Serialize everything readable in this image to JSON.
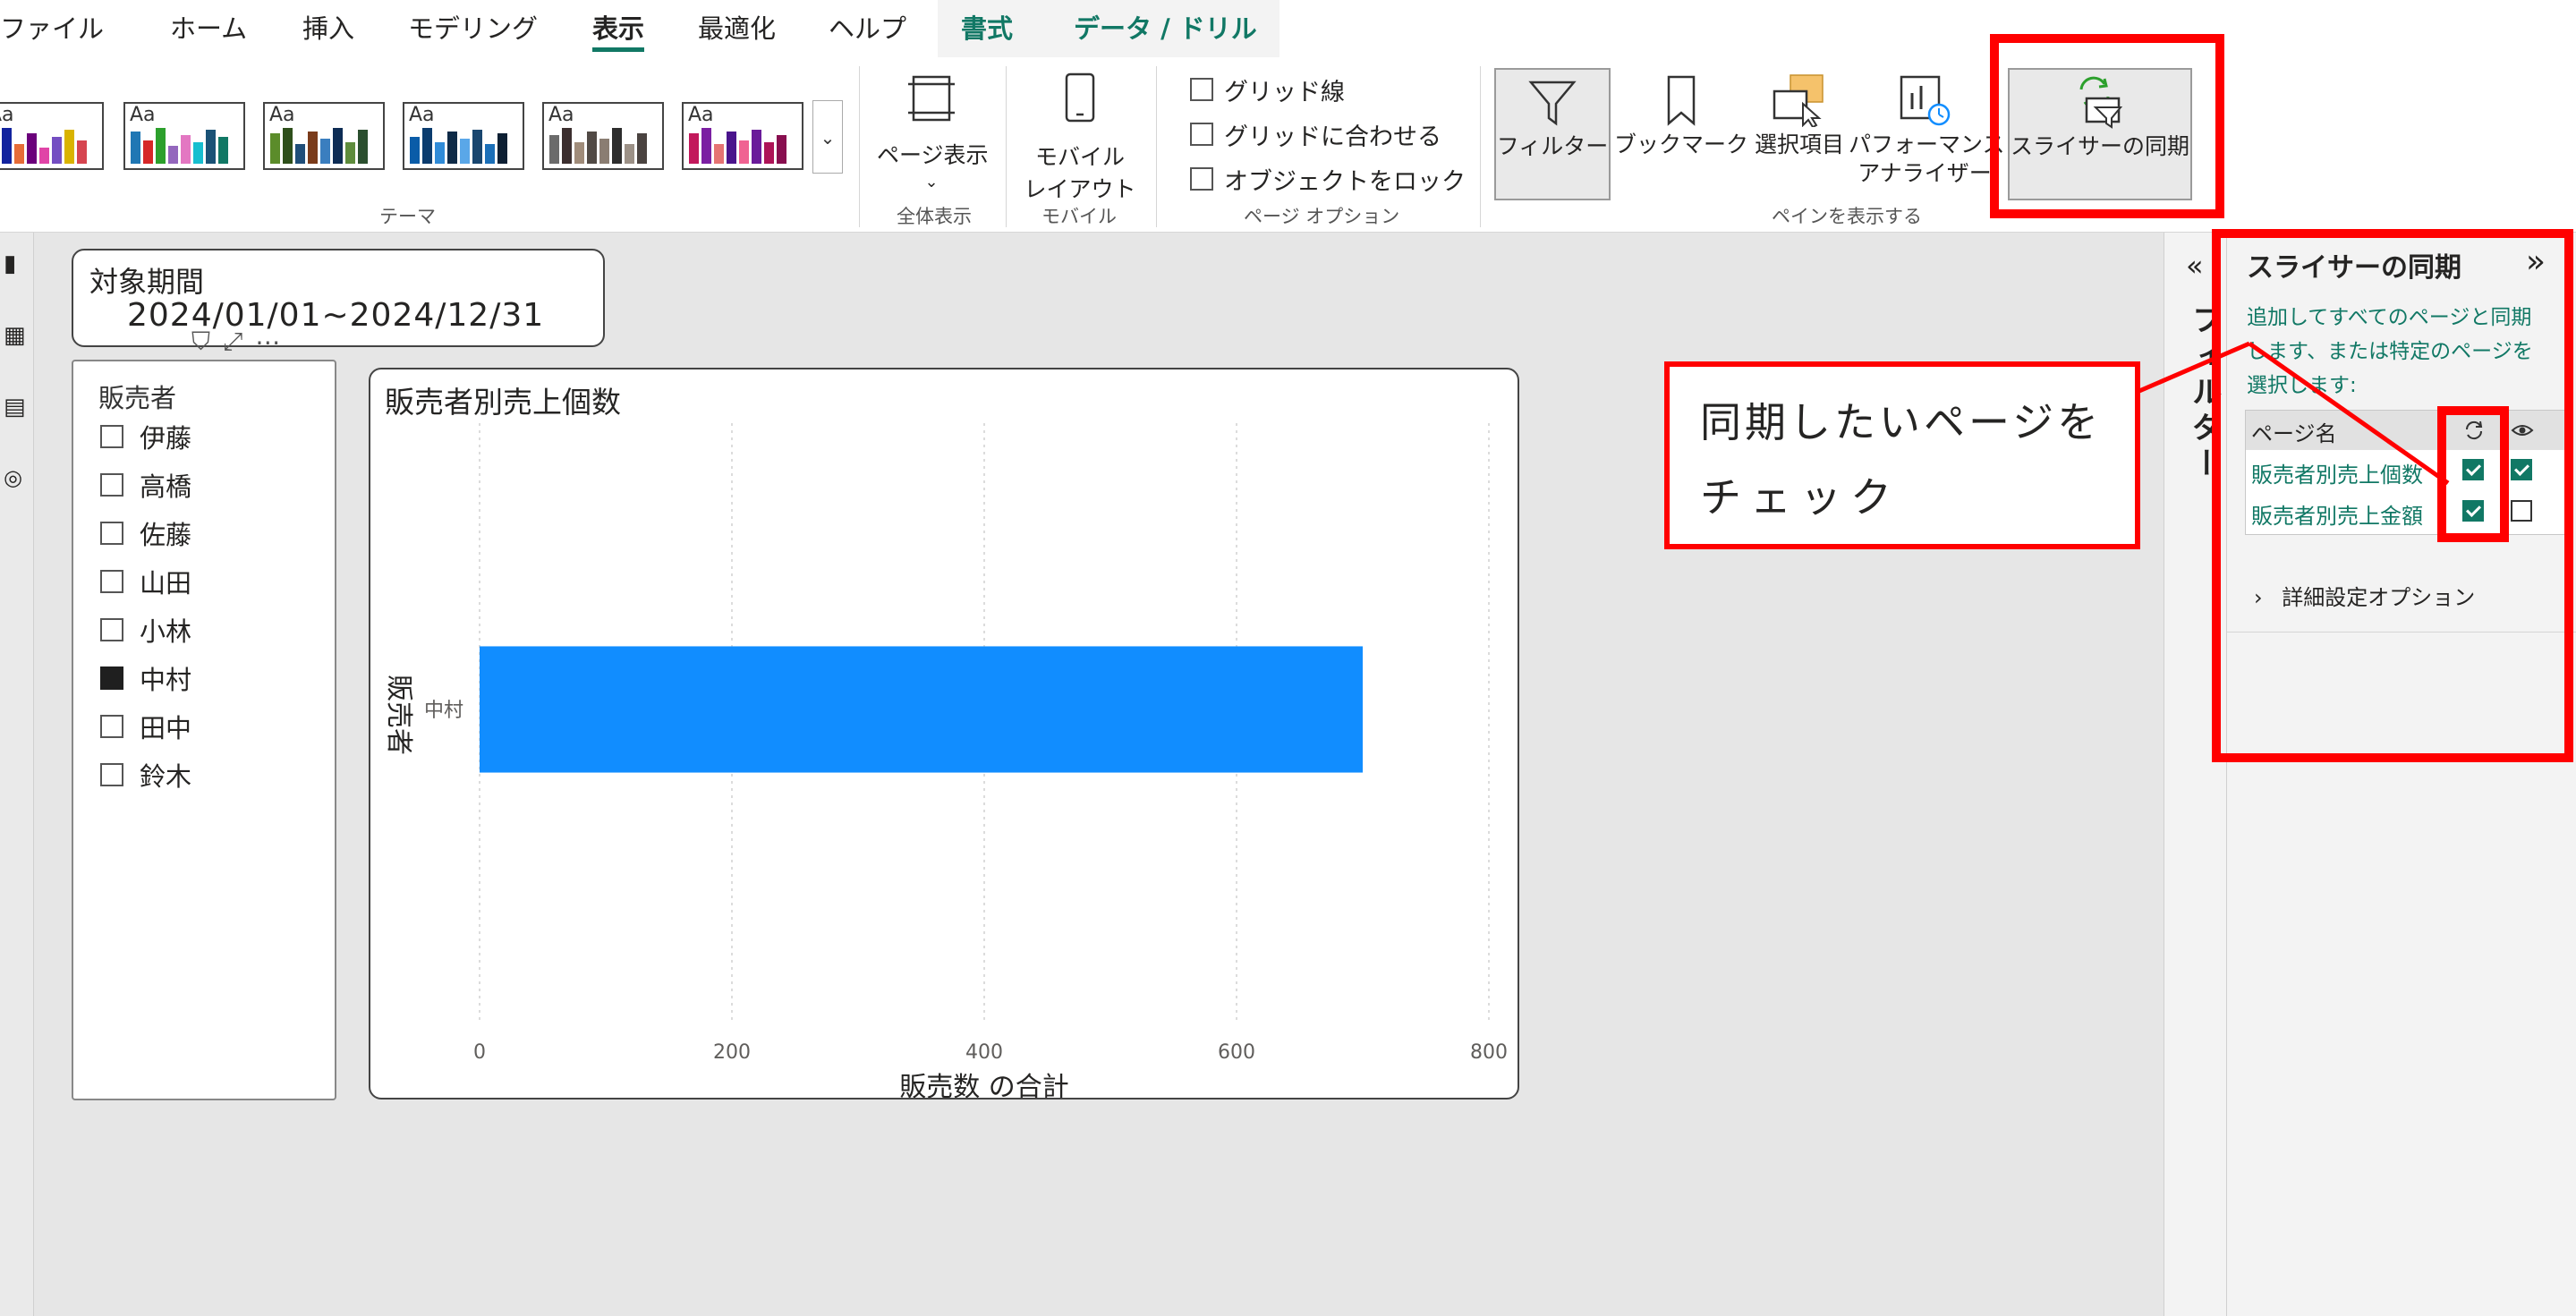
{
  "menu": {
    "tabs": [
      "ファイル",
      "ホーム",
      "挿入",
      "モデリング",
      "表示",
      "最適化",
      "ヘルプ"
    ],
    "active": "表示",
    "context_tabs": [
      "書式",
      "データ / ドリル"
    ]
  },
  "ribbon": {
    "theme_group": "テーマ",
    "page_view": {
      "label": "ページ表示",
      "group": "全体表示"
    },
    "mobile": {
      "label_line1": "モバイル",
      "label_line2": "レイアウト",
      "group": "モバイル"
    },
    "page_options": {
      "gridlines": "グリッド線",
      "snap_to_grid": "グリッドに合わせる",
      "lock_objects": "オブジェクトをロック",
      "group": "ページ オプション"
    },
    "show_panes": {
      "filter": "フィルター",
      "bookmark": "ブックマーク",
      "selection": "選択項目",
      "performance_line1": "パフォーマンス",
      "performance_line2": "アナライザー",
      "sync_slicers": "スライサーの同期",
      "group": "ペインを表示する"
    }
  },
  "date_card": {
    "label": "対象期間",
    "value": "2024/01/01~2024/12/31"
  },
  "slicer": {
    "title": "販売者",
    "items": [
      {
        "name": "伊藤",
        "checked": false
      },
      {
        "name": "高橋",
        "checked": false
      },
      {
        "name": "佐藤",
        "checked": false
      },
      {
        "name": "山田",
        "checked": false
      },
      {
        "name": "小林",
        "checked": false
      },
      {
        "name": "中村",
        "checked": true
      },
      {
        "name": "田中",
        "checked": false
      },
      {
        "name": "鈴木",
        "checked": false
      }
    ]
  },
  "chart_data": {
    "type": "bar",
    "orientation": "horizontal",
    "title": "販売者別売上個数",
    "categories": [
      "中村"
    ],
    "values": [
      700
    ],
    "xlabel": "販売数 の合計",
    "ylabel": "販売者",
    "xlim": [
      0,
      800
    ],
    "xticks": [
      0,
      200,
      400,
      600,
      800
    ],
    "bar_color": "#118DFF",
    "grid": "vertical dotted"
  },
  "filters_collapsed": {
    "label": "フィルター"
  },
  "sync_pane": {
    "title": "スライサーの同期",
    "description": "追加してすべてのページと同期します、または特定のページを選択します:",
    "column_header": "ページ名",
    "rows": [
      {
        "name": "販売者別売上個数",
        "sync": true,
        "visible": true
      },
      {
        "name": "販売者別売上金額",
        "sync": true,
        "visible": false
      }
    ],
    "advanced": "詳細設定オプション"
  },
  "annotation": {
    "line1": "同期したいページを",
    "line2": "チェック",
    "color": "#ff0000"
  },
  "colors": {
    "accent": "#117865",
    "bar": "#118DFF"
  }
}
